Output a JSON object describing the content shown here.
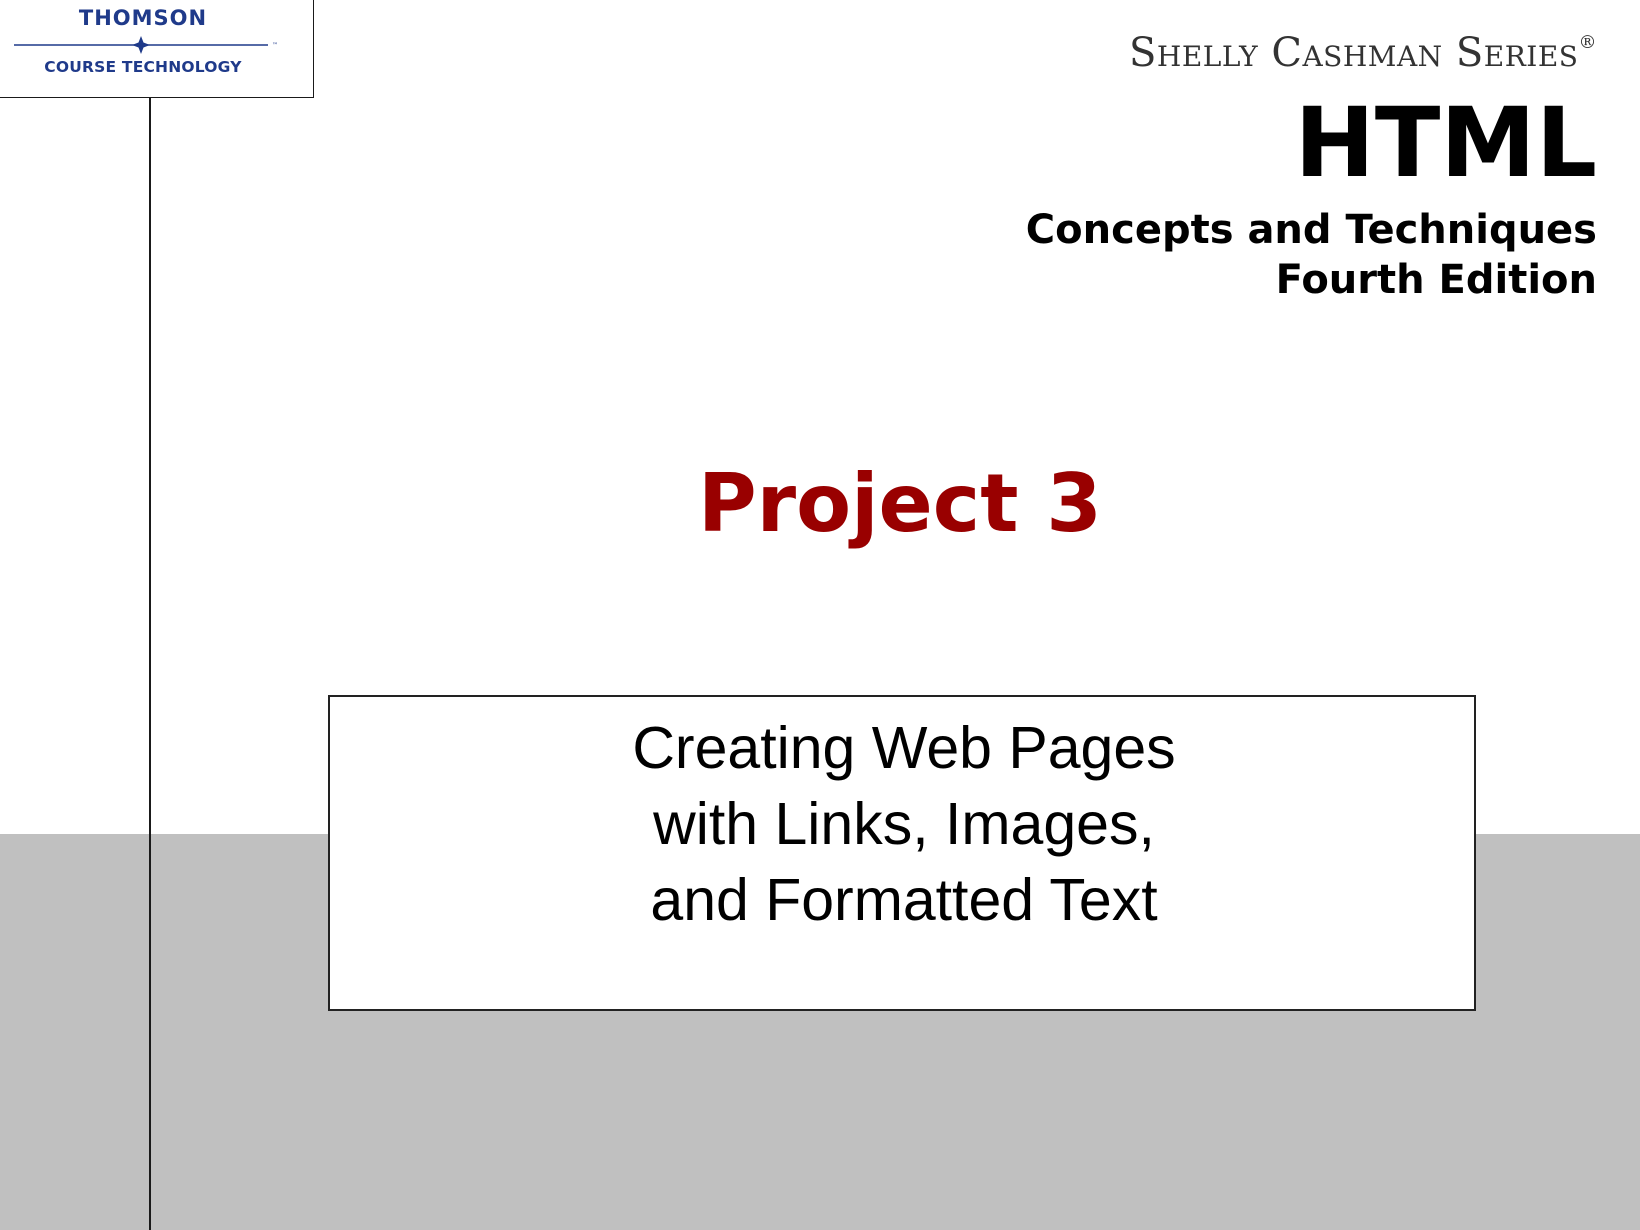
{
  "logo": {
    "name": "THOMSON",
    "sub": "COURSE TECHNOLOGY",
    "trademark": "™"
  },
  "series": {
    "name": "Shelly Cashman Series",
    "registered": "®"
  },
  "book": {
    "title": "HTML",
    "subtitle": "Concepts and Techniques",
    "edition": "Fourth Edition"
  },
  "slide": {
    "project": "Project 3",
    "lines": [
      "Creating Web Pages",
      "with Links, Images,",
      "and Formatted Text"
    ]
  },
  "colors": {
    "project_red": "#990000",
    "band_gray": "#c0c0c0",
    "logo_blue": "#1f3a8a"
  }
}
